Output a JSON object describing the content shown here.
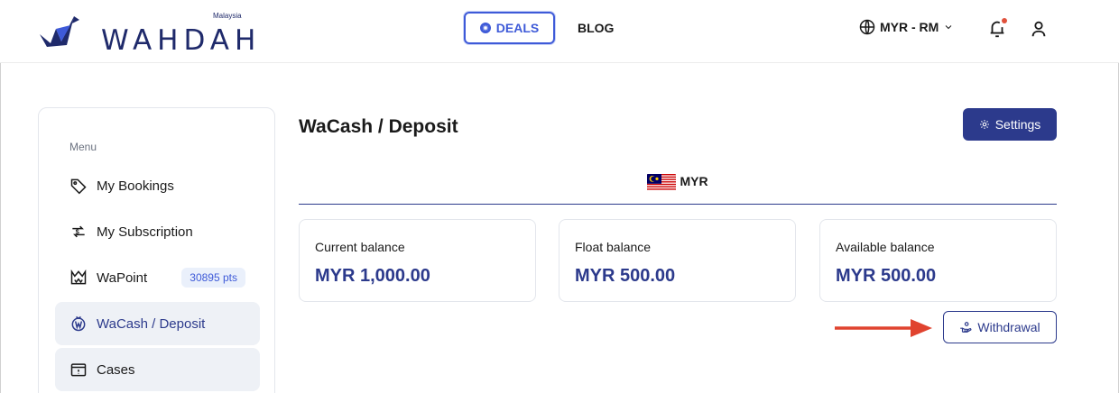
{
  "brand": {
    "name": "WAHDAH",
    "country": "Malaysia"
  },
  "header": {
    "nav": {
      "deals": "DEALS",
      "blog": "BLOG"
    },
    "currency": "MYR - RM"
  },
  "sidebar": {
    "title": "Menu",
    "items": [
      {
        "label": "My Bookings",
        "icon": "tag-icon"
      },
      {
        "label": "My Subscription",
        "icon": "subscription-icon"
      },
      {
        "label": "WaPoint",
        "icon": "crown-icon",
        "badge": "30895 pts"
      },
      {
        "label": "WaCash / Deposit",
        "icon": "wacash-icon"
      },
      {
        "label": "Cases",
        "icon": "cases-icon"
      }
    ]
  },
  "main": {
    "title": "WaCash / Deposit",
    "settings_label": "Settings",
    "currency_tab": "MYR",
    "balances": [
      {
        "label": "Current balance",
        "value": "MYR 1,000.00"
      },
      {
        "label": "Float balance",
        "value": "MYR 500.00"
      },
      {
        "label": "Available balance",
        "value": "MYR 500.00"
      }
    ],
    "withdrawal_label": "Withdrawal"
  },
  "colors": {
    "primary": "#2c3a8c",
    "accent": "#3e5ad8",
    "arrow": "#e0432f"
  }
}
